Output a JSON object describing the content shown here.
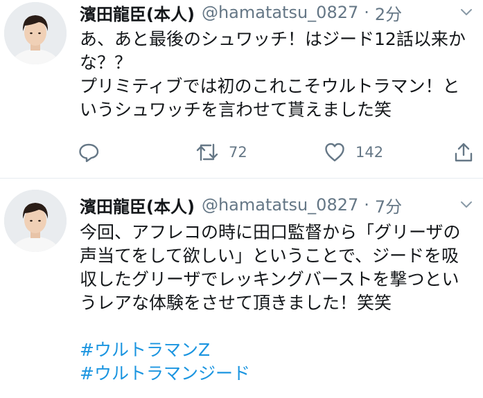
{
  "tweets": [
    {
      "name": "濱田龍臣(本人)",
      "handle": "@hamatatsu_0827",
      "separator": "·",
      "time": "2分",
      "lines": [
        "あ、あと最後のシュワッチ！はジード12話以来か",
        "な？？",
        "プリミティブでは初のこれこそウルトラマン！と",
        "いうシュワッチを言わせて貰えました笑"
      ],
      "retweets": "72",
      "likes": "142"
    },
    {
      "name": "濱田龍臣(本人)",
      "handle": "@hamatatsu_0827",
      "separator": "·",
      "time": "7分",
      "lines": [
        "今回、アフレコの時に田口監督から「グリーザの",
        "声当てをして欲しい」ということで、ジードを吸",
        "収したグリーザでレッキングバーストを撃つとい",
        "うレアな体験をさせて頂きました！笑笑"
      ],
      "hashtags": [
        "#ウルトラマンZ",
        "#ウルトラマンジード"
      ]
    }
  ],
  "colors": {
    "text": "#14171a",
    "secondary": "#657786",
    "link": "#1b95e0",
    "divider": "#e6ecf0"
  },
  "icons": [
    "reply-icon",
    "retweet-icon",
    "like-icon",
    "share-icon",
    "chevron-down-icon"
  ]
}
